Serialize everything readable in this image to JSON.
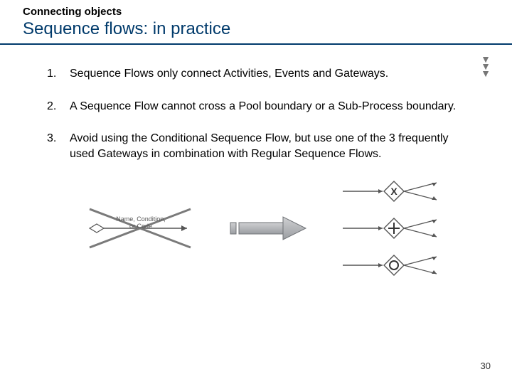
{
  "header": {
    "eyebrow": "Connecting objects",
    "title": "Sequence flows: in practice"
  },
  "list": {
    "items": [
      "Sequence Flows only connect Activities, Events and Gateways.",
      "A Sequence Flow cannot cross a Pool boundary or a Sub-Process boundary.",
      "Avoid using the Conditional Sequence Flow, but use one of the 3 frequently used Gateways in combination with Regular Sequence Flows."
    ]
  },
  "figure": {
    "conditional_label_line1": "Name, Condition,",
    "conditional_label_line2": "or Code"
  },
  "page_number": "30"
}
